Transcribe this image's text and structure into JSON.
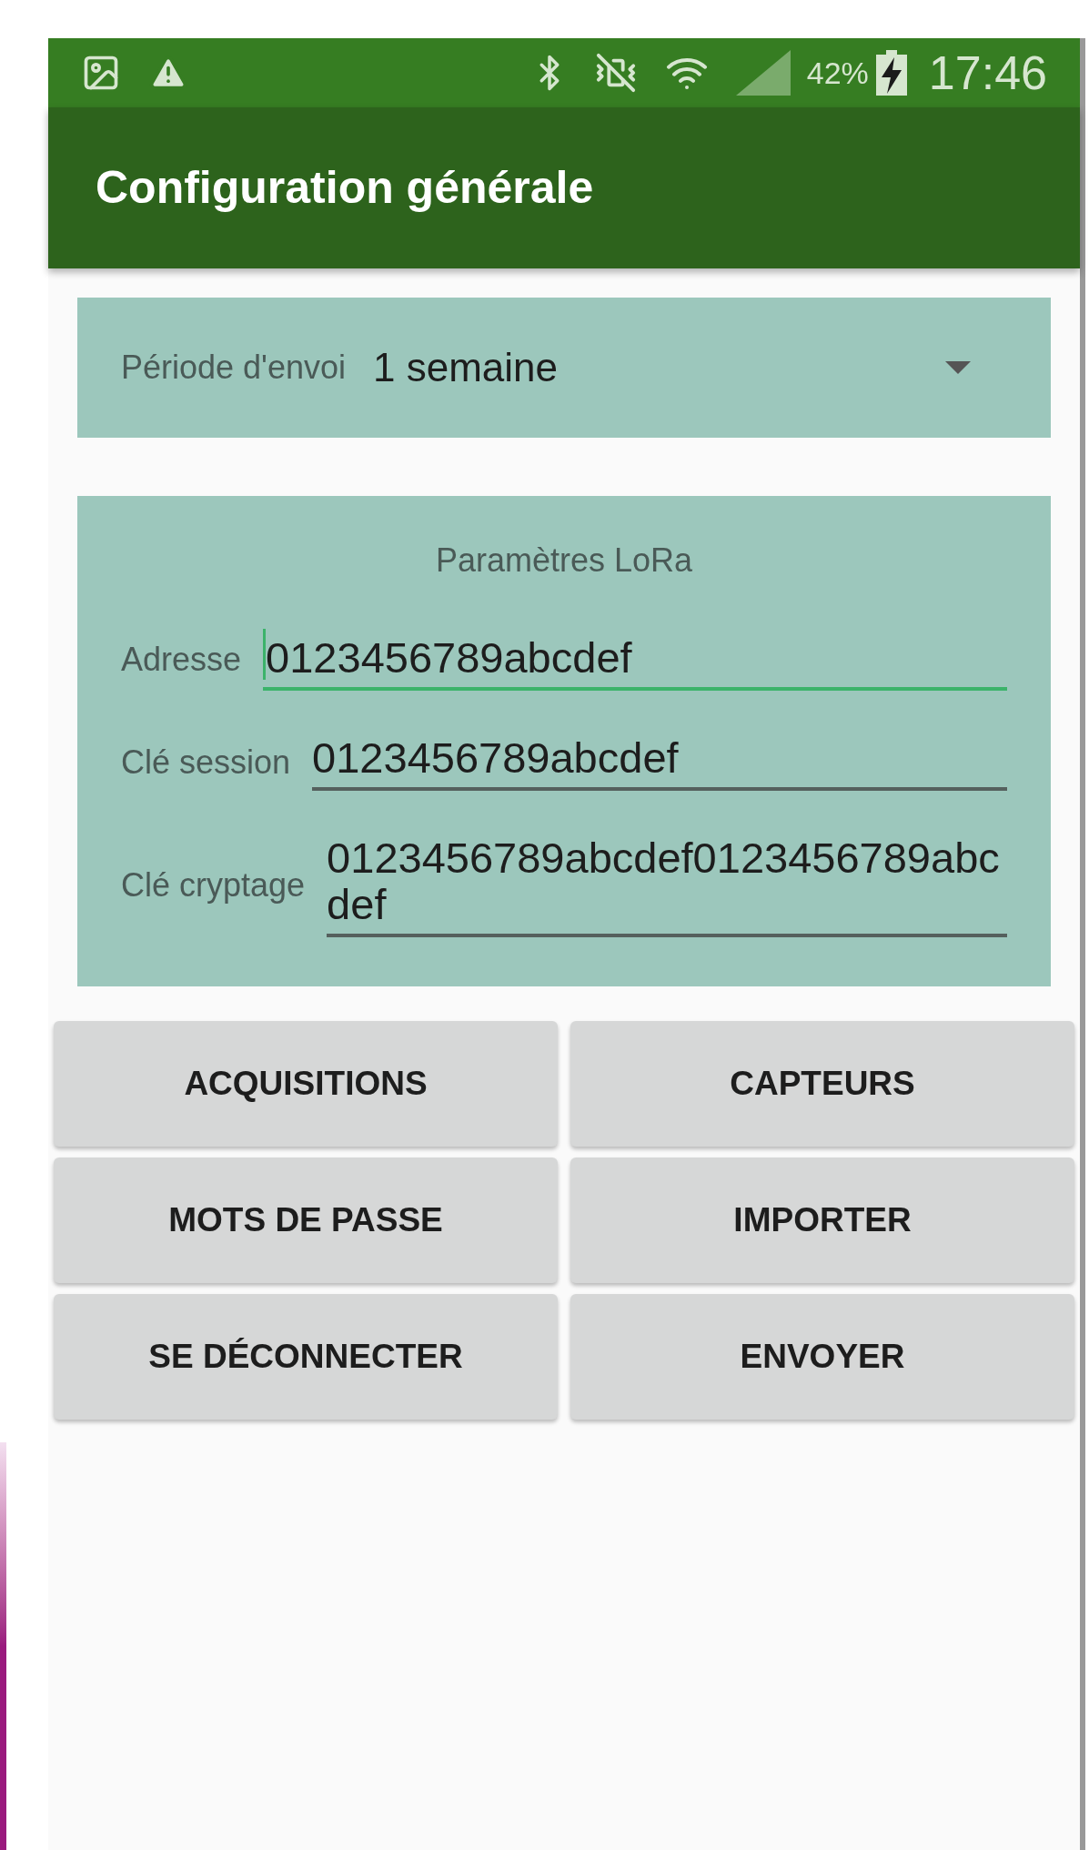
{
  "status_bar": {
    "battery": "42%",
    "time": "17:46"
  },
  "app_bar": {
    "title": "Configuration générale"
  },
  "period": {
    "label": "Période d'envoi",
    "value": "1 semaine"
  },
  "lora": {
    "title": "Paramètres LoRa",
    "fields": [
      {
        "label": "Adresse",
        "value": "0123456789abcdef",
        "focused": true
      },
      {
        "label": "Clé session",
        "value": "0123456789abcdef",
        "focused": false
      },
      {
        "label": "Clé cryptage",
        "value": "0123456789abcdef0123456789abcdef",
        "focused": false
      }
    ]
  },
  "buttons": [
    "ACQUISITIONS",
    "CAPTEURS",
    "MOTS DE PASSE",
    "IMPORTER",
    "SE DÉCONNECTER",
    "ENVOYER"
  ]
}
